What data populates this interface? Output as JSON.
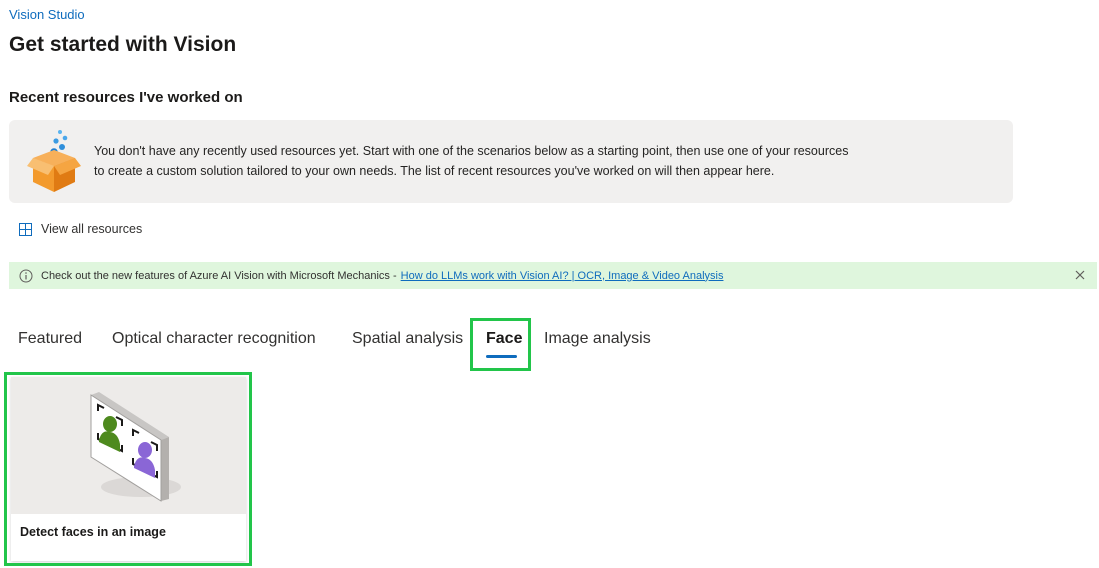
{
  "breadcrumb": "Vision Studio",
  "page_title": "Get started with Vision",
  "recent": {
    "title": "Recent resources I've worked on",
    "empty_line1": "You don't have any recently used resources yet. Start with one of the scenarios below as a starting point, then use one of your resources",
    "empty_line2": "to create a custom solution tailored to your own needs. The list of recent resources you've worked on will then appear here.",
    "illustration_icon": "open-box-icon"
  },
  "view_all": {
    "label": "View all resources",
    "icon": "grid-icon"
  },
  "banner": {
    "text": "Check out the new features of Azure AI Vision with Microsoft Mechanics -",
    "link": "How do LLMs work with Vision AI? | OCR, Image & Video Analysis",
    "info_icon": "info-icon",
    "close_icon": "close-icon"
  },
  "tabs": [
    {
      "label": "Featured",
      "active": false
    },
    {
      "label": "Optical character recognition",
      "active": false
    },
    {
      "label": "Spatial analysis",
      "active": false
    },
    {
      "label": "Face",
      "active": true
    },
    {
      "label": "Image analysis",
      "active": false
    }
  ],
  "scenarios": [
    {
      "label": "Detect faces in an image",
      "icon": "face-detection-illustration"
    }
  ],
  "colors": {
    "accent": "#0f6cbd",
    "highlight": "#22c54a",
    "banner_bg": "#dff6dd"
  }
}
